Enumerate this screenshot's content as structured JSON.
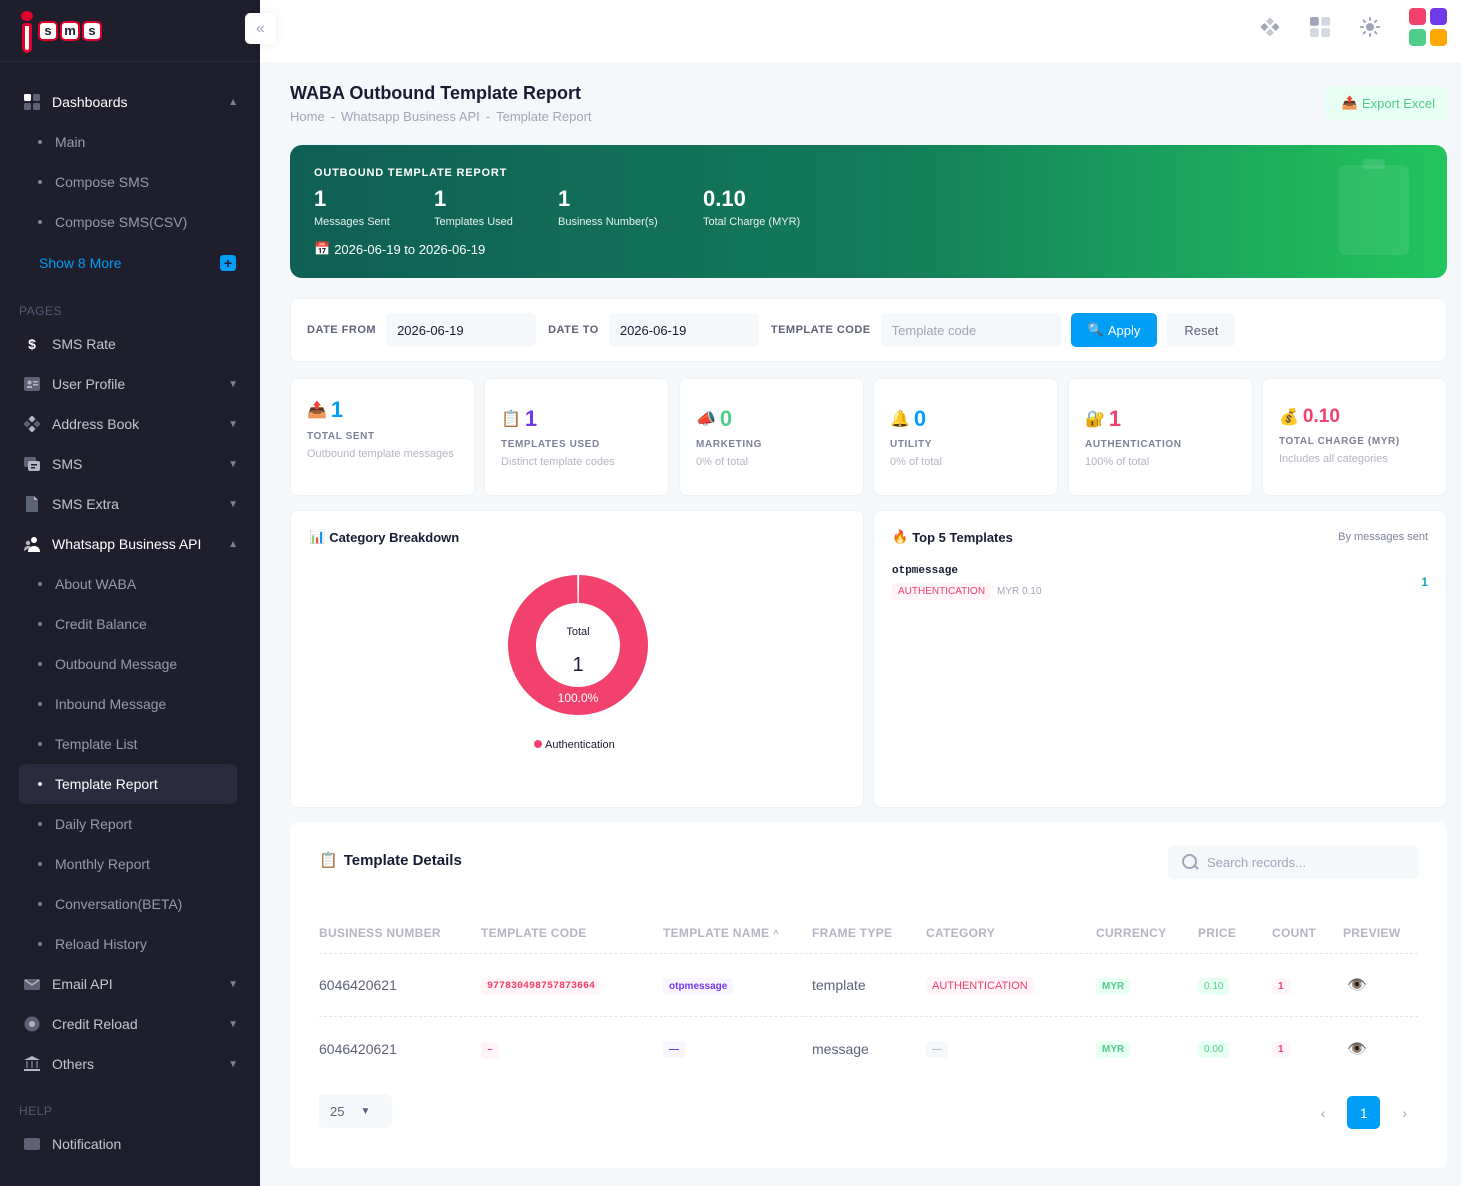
{
  "logo": {
    "letters": [
      "s",
      "m",
      "s"
    ]
  },
  "sidebar": {
    "dashboards": {
      "label": "Dashboards",
      "items": [
        "Main",
        "Compose SMS",
        "Compose SMS(CSV)"
      ],
      "show_more": "Show 8 More"
    },
    "pages_title": "PAGES",
    "items": [
      {
        "label": "SMS Rate",
        "icon": "dollar-icon"
      },
      {
        "label": "User Profile",
        "icon": "profile-icon"
      },
      {
        "label": "Address Book",
        "icon": "address-book-icon"
      },
      {
        "label": "SMS",
        "icon": "sms-icon"
      },
      {
        "label": "SMS Extra",
        "icon": "document-icon"
      },
      {
        "label": "Whatsapp Business API",
        "icon": "users-icon"
      }
    ],
    "waba_items": [
      "About WABA",
      "Credit Balance",
      "Outbound Message",
      "Inbound Message",
      "Template List",
      "Template Report",
      "Daily Report",
      "Monthly Report",
      "Conversation(BETA)",
      "Reload History"
    ],
    "bottom_items": [
      {
        "label": "Email API",
        "icon": "email-icon"
      },
      {
        "label": "Credit Reload",
        "icon": "credit-icon"
      },
      {
        "label": "Others",
        "icon": "bank-icon"
      }
    ],
    "help_title": "HELP",
    "help_item": "Notification"
  },
  "header": {
    "apps_colors": [
      "#f1416c",
      "#7239ea",
      "#50cd89",
      "#ffa800"
    ]
  },
  "page": {
    "title": "WABA Outbound Template Report",
    "breadcrumb": [
      "Home",
      "-",
      "Whatsapp Business API",
      "-",
      "Template Report"
    ],
    "export_label": "Export Excel"
  },
  "hero": {
    "label": "OUTBOUND TEMPLATE REPORT",
    "stats": [
      {
        "value": "1",
        "label": "Messages Sent"
      },
      {
        "value": "1",
        "label": "Templates Used"
      },
      {
        "value": "1",
        "label": "Business Number(s)"
      },
      {
        "value": "0.10",
        "label": "Total Charge (MYR)"
      }
    ],
    "date_range": "2026-06-19 to 2026-06-19"
  },
  "filter": {
    "date_from_label": "DATE FROM",
    "date_from": "2026-06-19",
    "date_to_label": "DATE TO",
    "date_to": "2026-06-19",
    "template_code_label": "TEMPLATE CODE",
    "template_code_placeholder": "Template code",
    "apply": "Apply",
    "reset": "Reset"
  },
  "stats": [
    {
      "emoji": "📤",
      "value": "1",
      "label": "TOTAL SENT",
      "desc": "Outbound template messages",
      "color": "#009ef7"
    },
    {
      "emoji": "📋",
      "value": "1",
      "label": "TEMPLATES USED",
      "desc": "Distinct template codes",
      "color": "#7239ea"
    },
    {
      "emoji": "📣",
      "value": "0",
      "label": "MARKETING",
      "desc": "0% of total",
      "color": "#50cd89"
    },
    {
      "emoji": "🔔",
      "value": "0",
      "label": "UTILITY",
      "desc": "0% of total",
      "color": "#009ef7"
    },
    {
      "emoji": "🔐",
      "value": "1",
      "label": "AUTHENTICATION",
      "desc": "100% of total",
      "color": "#f1416c"
    },
    {
      "emoji": "💰",
      "value": "0.10",
      "label": "TOTAL CHARGE (MYR)",
      "desc": "Includes all categories",
      "color": "#f1416c"
    }
  ],
  "category_breakdown": {
    "title": "Category Breakdown",
    "emoji": "📊"
  },
  "chart_data": {
    "type": "pie",
    "categories": [
      "Authentication"
    ],
    "values": [
      1
    ],
    "center_label": "Total",
    "center_value": "1",
    "slice_label": "100.0%",
    "colors": [
      "#f1416c"
    ],
    "legend_position": "bottom"
  },
  "top_templates": {
    "title": "Top 5 Templates",
    "emoji": "🔥",
    "subtitle": "By messages sent",
    "items": [
      {
        "code": "otpmessage",
        "category": "AUTHENTICATION",
        "price": "MYR 0.10",
        "count": "1"
      }
    ]
  },
  "details": {
    "title": "Template Details",
    "emoji": "📋",
    "search_placeholder": "Search records...",
    "columns": [
      "BUSINESS NUMBER",
      "TEMPLATE CODE",
      "TEMPLATE NAME",
      "FRAME TYPE",
      "CATEGORY",
      "CURRENCY",
      "PRICE",
      "COUNT",
      "PREVIEW"
    ],
    "sort_indicator": "^",
    "rows": [
      {
        "business_number": "6046420621",
        "template_code": "977830498757873664",
        "template_name": "otpmessage",
        "frame_type": "template",
        "category": "AUTHENTICATION",
        "currency": "MYR",
        "price": "0.10",
        "count": "1"
      },
      {
        "business_number": "6046420621",
        "template_code": "–",
        "template_name": "—",
        "frame_type": "message",
        "category": "—",
        "currency": "MYR",
        "price": "0.00",
        "count": "1"
      }
    ],
    "page_size": "25",
    "current_page": "1"
  }
}
